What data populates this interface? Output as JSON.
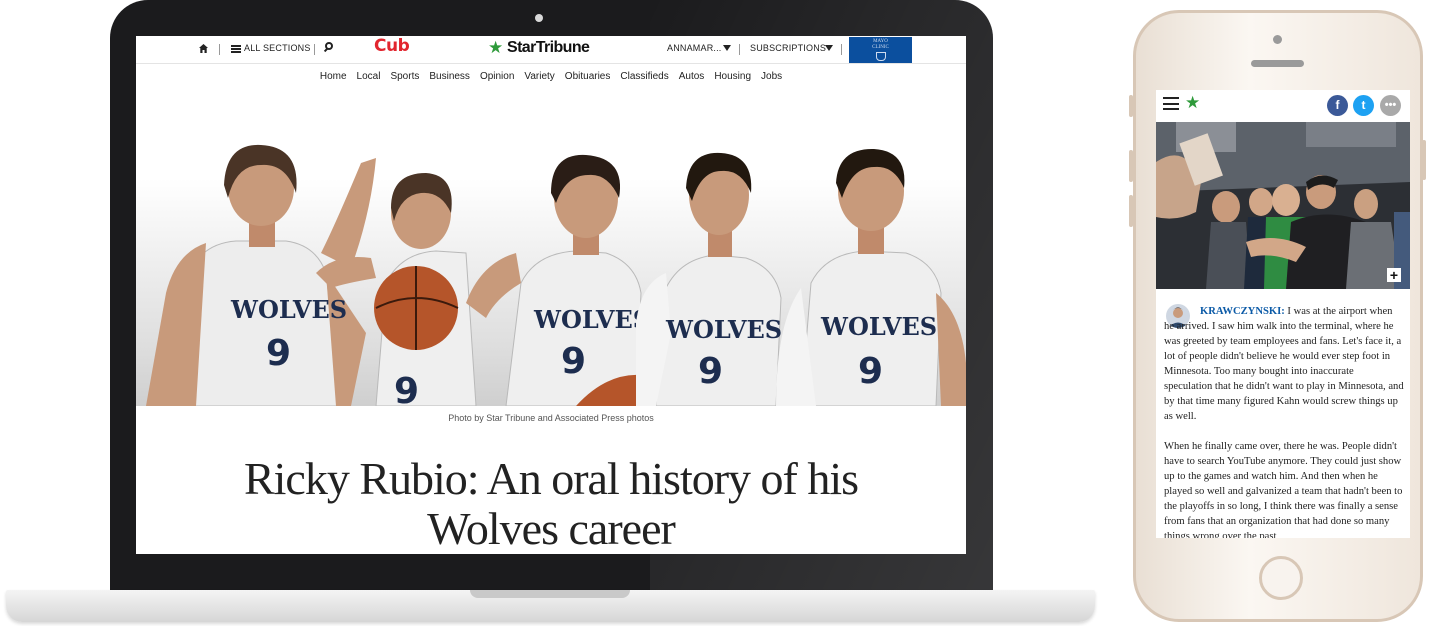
{
  "laptop": {
    "topbar": {
      "all_sections": "ALL SECTIONS",
      "cub_logo": "Cub",
      "brand_name": "StarTribune",
      "brand_star": "★",
      "user": "ANNAMAR...",
      "subscriptions": "SUBSCRIPTIONS",
      "mayo_line1": "MAYO",
      "mayo_line2": "CLINIC"
    },
    "nav": [
      "Home",
      "Local",
      "Sports",
      "Business",
      "Opinion",
      "Variety",
      "Obituaries",
      "Classifieds",
      "Autos",
      "Housing",
      "Jobs"
    ],
    "hero": {
      "jersey_text": "WOLVES",
      "jersey_number": "9"
    },
    "photo_credit": "Photo by Star Tribune and Associated Press photos",
    "headline_line1": "Ricky Rubio: An oral history of his",
    "headline_line2": "Wolves career"
  },
  "phone": {
    "brand_star": "★",
    "share": {
      "facebook": "f",
      "twitter": "t",
      "more": "•••"
    },
    "expand": "+",
    "speaker": "KRAWCZYNSKI:",
    "para1": "I was at the airport when he arrived. I saw him walk into the terminal, where he was greeted by team employees and fans. Let's face it, a lot of people didn't believe he would ever step foot in Minnesota. Too many bought into inaccurate speculation that he didn't want to play in Minnesota, and by that time many figured Kahn would screw things up as well.",
    "para2": "When he finally came over, there he was. People didn't have to search YouTube anymore. They could just show up to the games and watch him. And then when he played so well and galvanized a team that hadn't been to the playoffs in so long, I think there was finally a sense from fans that an organization that had done so many things wrong over the past"
  },
  "colors": {
    "brand_green": "#2e9a3a",
    "cub_red": "#e2252e",
    "mayo_blue": "#0b4f9e",
    "speaker_blue": "#0b5aa7"
  }
}
